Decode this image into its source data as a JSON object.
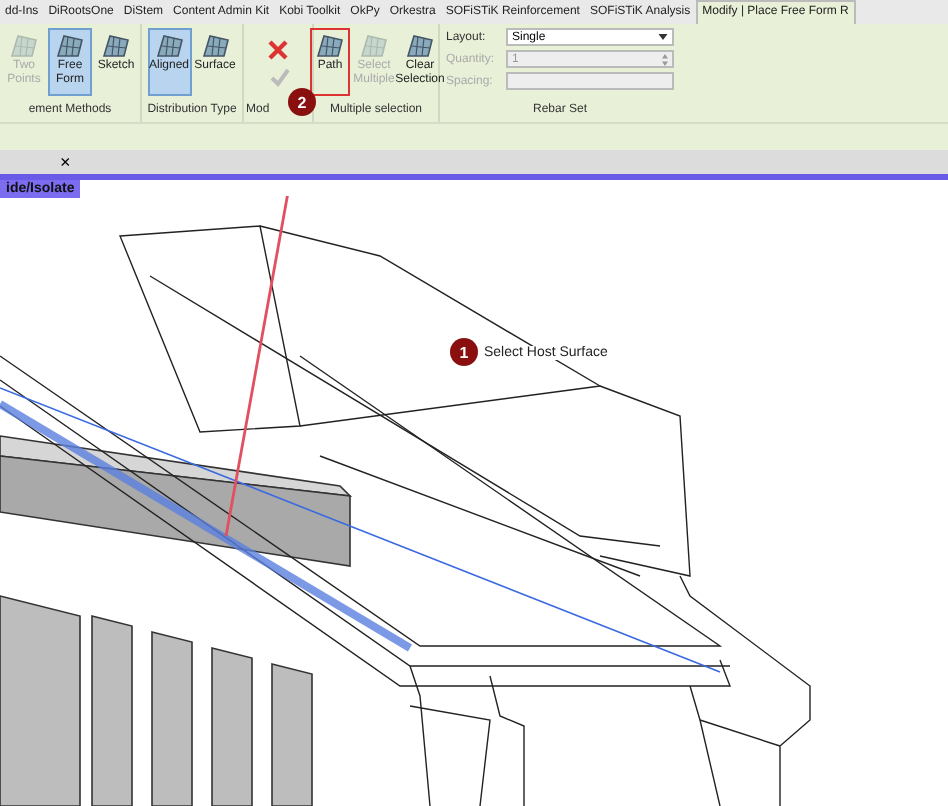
{
  "tabs": [
    {
      "label": "dd-Ins",
      "selected": false
    },
    {
      "label": "DiRootsOne",
      "selected": false
    },
    {
      "label": "DiStem",
      "selected": false
    },
    {
      "label": "Content Admin Kit",
      "selected": false
    },
    {
      "label": "Kobi Toolkit",
      "selected": false
    },
    {
      "label": "OkPy",
      "selected": false
    },
    {
      "label": "Orkestra",
      "selected": false
    },
    {
      "label": "SOFiSTiK Reinforcement",
      "selected": false
    },
    {
      "label": "SOFiSTiK Analysis",
      "selected": false
    },
    {
      "label": "Modify | Place Free Form R",
      "selected": true
    }
  ],
  "panels": [
    {
      "label": "ement Methods",
      "buttons": [
        {
          "label": "Two Points",
          "selected": false,
          "disabled": true,
          "outlined": false
        },
        {
          "label": "Free Form",
          "selected": true,
          "disabled": false,
          "outlined": false
        },
        {
          "label": "Sketch",
          "selected": false,
          "disabled": false,
          "outlined": false
        }
      ]
    },
    {
      "label": "Distribution Type",
      "buttons": [
        {
          "label": "Aligned",
          "selected": true,
          "disabled": false,
          "outlined": false
        },
        {
          "label": "Surface",
          "selected": false,
          "disabled": false,
          "outlined": false
        }
      ]
    },
    {
      "label": "Mod"
    },
    {
      "label": "Multiple selection",
      "buttons": [
        {
          "label": "Path",
          "selected": false,
          "disabled": false,
          "outlined": true
        },
        {
          "label": "Select Multiple",
          "selected": false,
          "disabled": true,
          "outlined": false
        },
        {
          "label": "Clear Selection",
          "selected": false,
          "disabled": false,
          "outlined": false
        }
      ]
    }
  ],
  "rebar_set": {
    "label": "Rebar Set",
    "fields": [
      {
        "label": "Layout:",
        "value": "Single",
        "kind": "dropdown",
        "disabled": false
      },
      {
        "label": "Quantity:",
        "value": "1",
        "kind": "spinner",
        "disabled": true
      },
      {
        "label": "Spacing:",
        "kind": "text",
        "disabled": true
      }
    ]
  },
  "view_tab": {
    "close": "×",
    "label": "ide/Isolate"
  },
  "callouts": [
    {
      "number": "1",
      "text": "Select Host Surface"
    },
    {
      "number": "2"
    }
  ]
}
